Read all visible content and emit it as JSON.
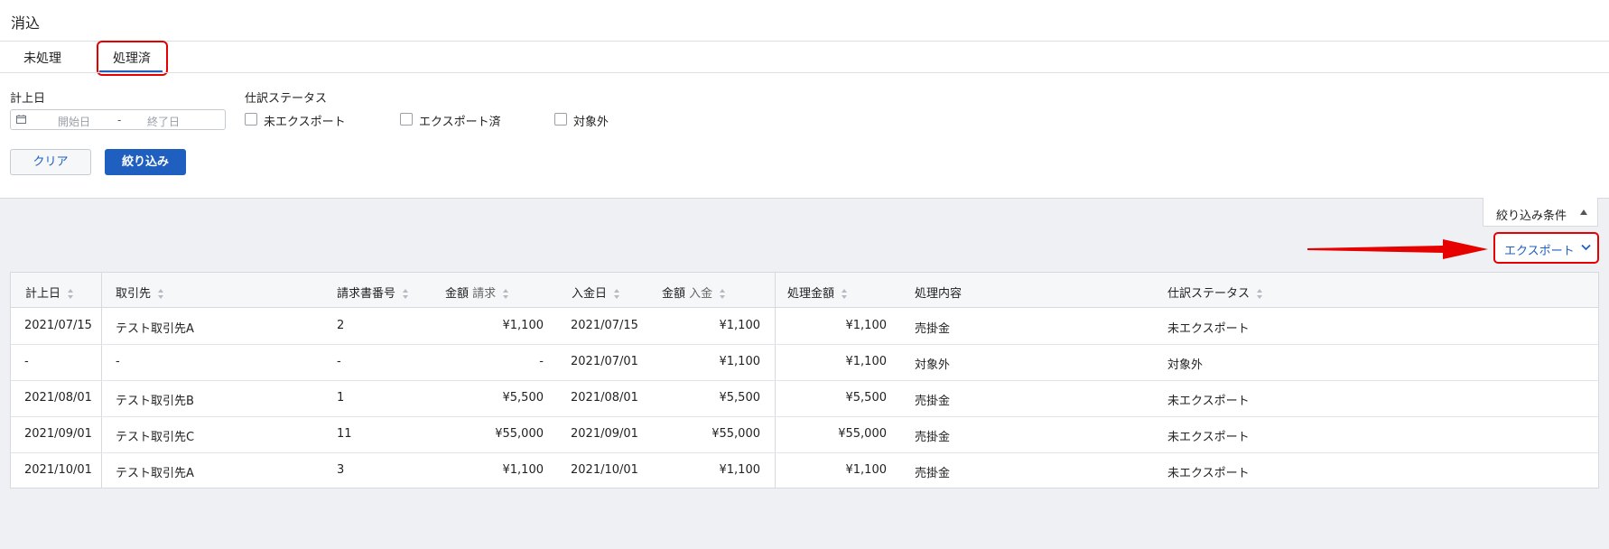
{
  "page": {
    "title": "消込"
  },
  "tabs": [
    {
      "label": "未処理"
    },
    {
      "label": "処理済"
    }
  ],
  "filters": {
    "date_label": "計上日",
    "date_start_placeholder": "開始日",
    "date_separator": "-",
    "date_end_placeholder": "終了日",
    "status_label": "仕訳ステータス",
    "status_options": [
      {
        "label": "未エクスポート",
        "checked": false
      },
      {
        "label": "エクスポート済",
        "checked": false
      },
      {
        "label": "対象外",
        "checked": false
      }
    ],
    "clear_label": "クリア",
    "apply_label": "絞り込み"
  },
  "toolbar": {
    "filter_conditions_label": "絞り込み条件",
    "export_label": "エクスポート"
  },
  "table": {
    "columns": [
      {
        "label": "計上日",
        "sub": ""
      },
      {
        "label": "取引先",
        "sub": ""
      },
      {
        "label": "請求書番号",
        "sub": ""
      },
      {
        "label": "金額",
        "sub": "請求"
      },
      {
        "label": "入金日",
        "sub": ""
      },
      {
        "label": "金額",
        "sub": "入金"
      },
      {
        "label": "処理金額",
        "sub": ""
      },
      {
        "label": "処理内容",
        "sub": ""
      },
      {
        "label": "仕訳ステータス",
        "sub": ""
      }
    ],
    "rows": [
      [
        "2021/07/15",
        "テスト取引先A",
        "2",
        "¥1,100",
        "2021/07/15",
        "¥1,100",
        "¥1,100",
        "売掛金",
        "未エクスポート"
      ],
      [
        "-",
        "-",
        "-",
        "-",
        "2021/07/01",
        "¥1,100",
        "¥1,100",
        "対象外",
        "対象外"
      ],
      [
        "2021/08/01",
        "テスト取引先B",
        "1",
        "¥5,500",
        "2021/08/01",
        "¥5,500",
        "¥5,500",
        "売掛金",
        "未エクスポート"
      ],
      [
        "2021/09/01",
        "テスト取引先C",
        "11",
        "¥55,000",
        "2021/09/01",
        "¥55,000",
        "¥55,000",
        "売掛金",
        "未エクスポート"
      ],
      [
        "2021/10/01",
        "テスト取引先A",
        "3",
        "¥1,100",
        "2021/10/01",
        "¥1,100",
        "¥1,100",
        "売掛金",
        "未エクスポート"
      ]
    ]
  },
  "colors": {
    "accent": "#1f5fbf",
    "highlight": "#e60000"
  }
}
